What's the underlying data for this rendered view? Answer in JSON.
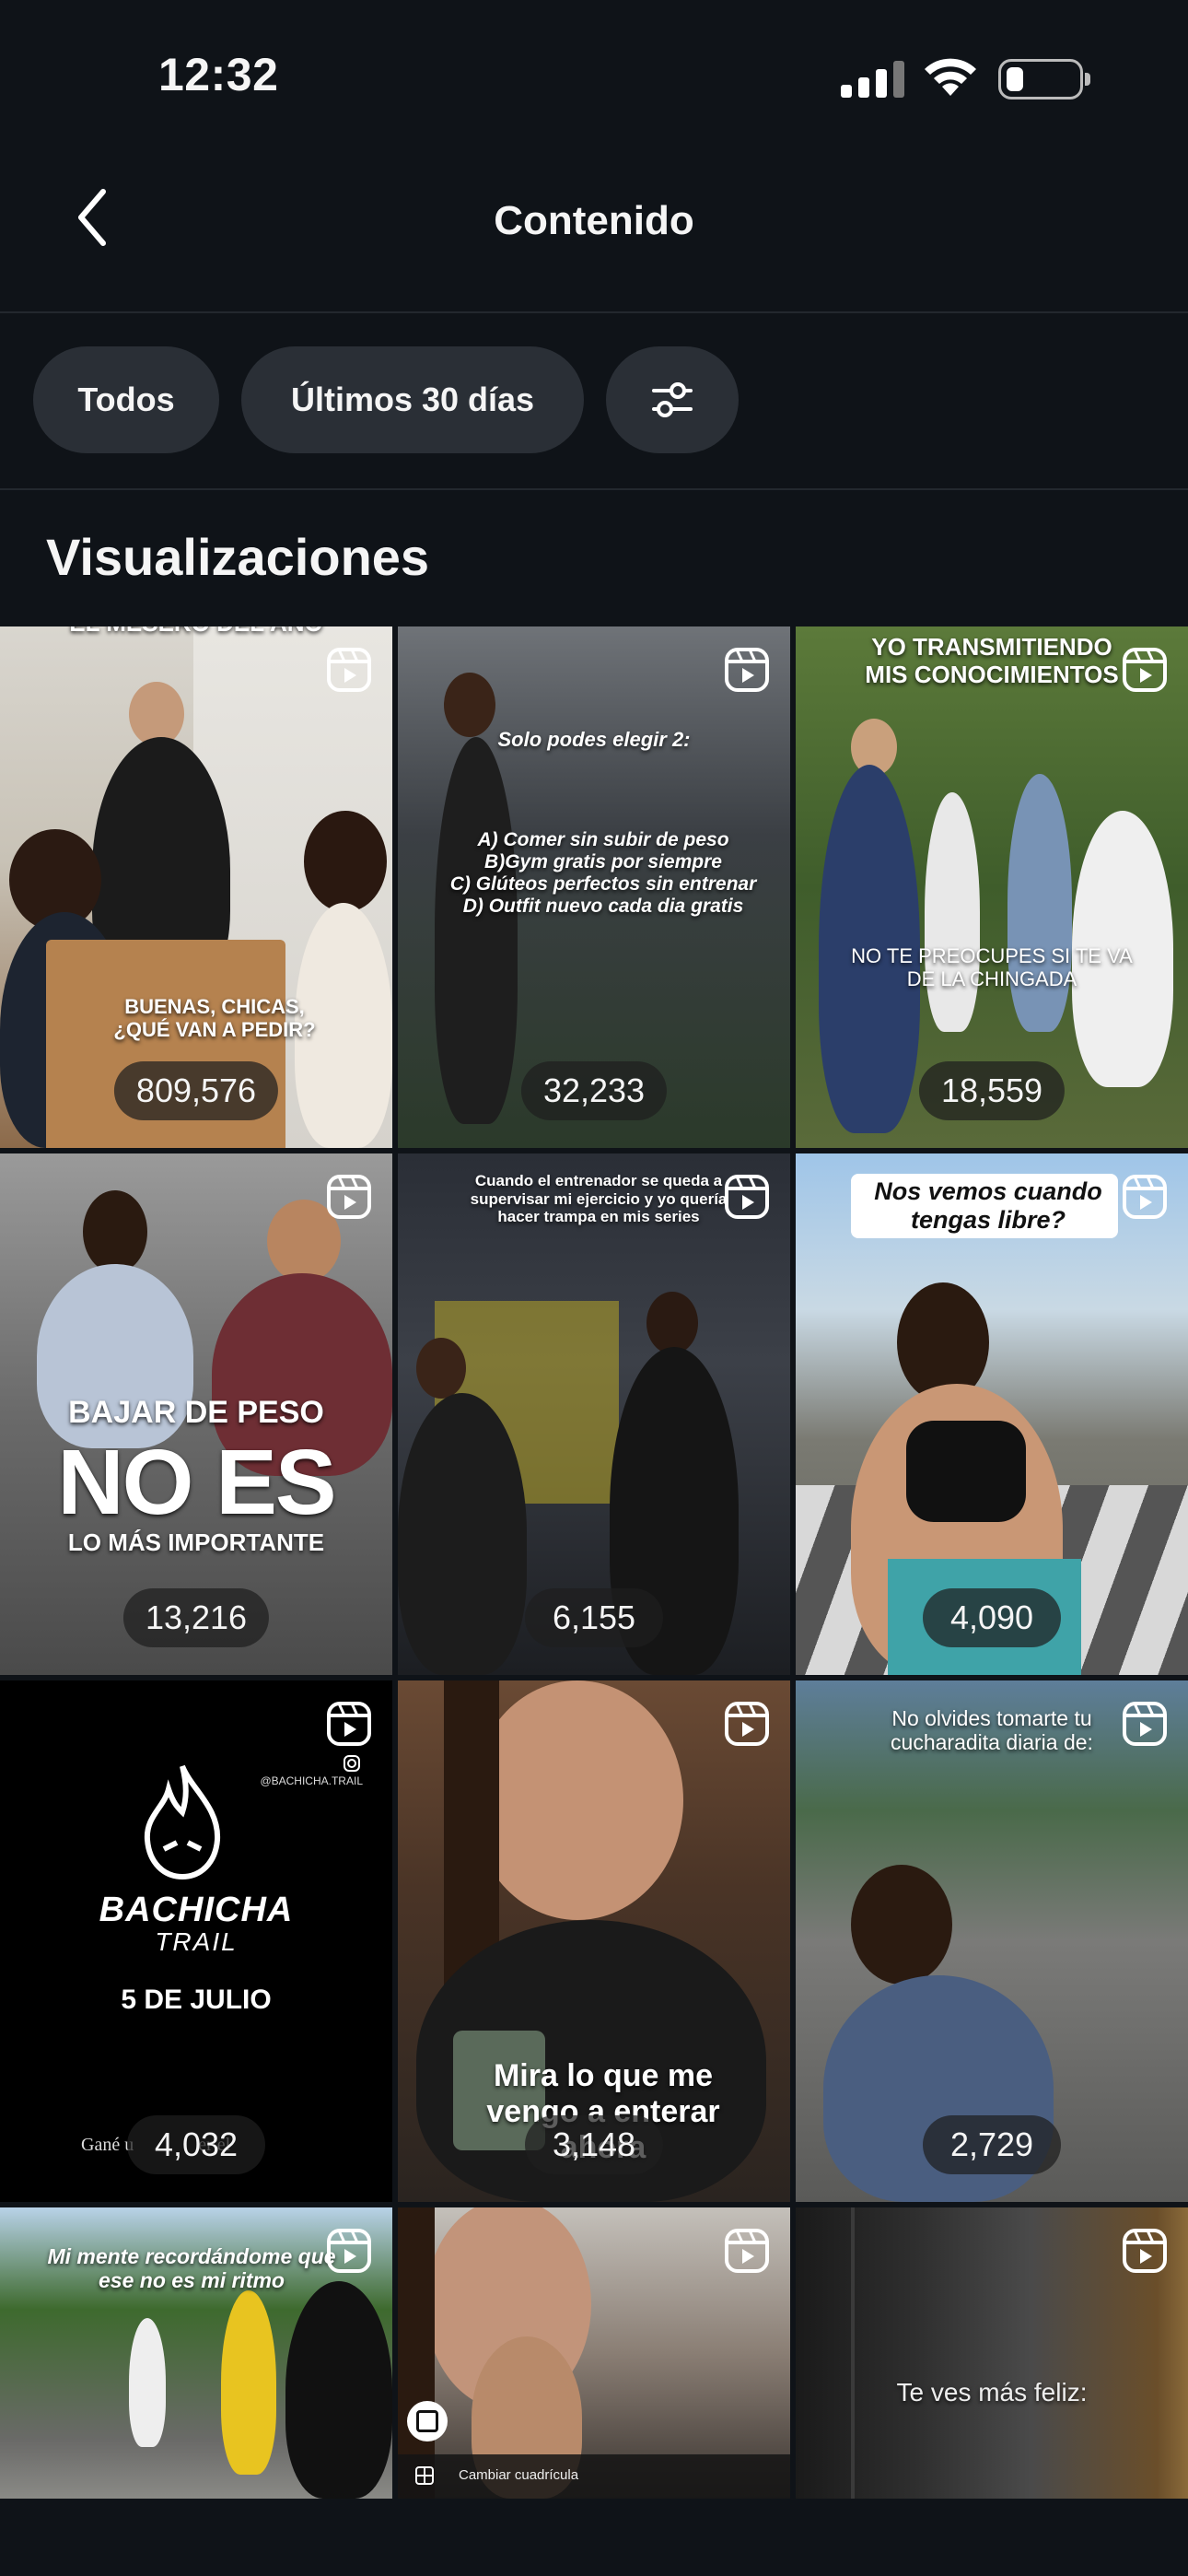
{
  "status": {
    "time": "12:32"
  },
  "header": {
    "title": "Contenido",
    "back_icon": "chevron-left-icon"
  },
  "filters": {
    "chips": [
      {
        "label": "Todos"
      },
      {
        "label": "Últimos 30 días"
      }
    ],
    "settings_icon": "sliders-icon"
  },
  "section": {
    "title": "Visualizaciones"
  },
  "tiles": [
    {
      "count": "809,576",
      "top_text": "EL MESERO DEL AÑO",
      "caption": "BUENAS, CHICAS,\n¿QUÉ VAN A PEDIR?"
    },
    {
      "count": "32,233",
      "top_text": "Solo podes elegir 2:",
      "caption": "A) Comer sin subir de peso\nB)Gym gratis por siempre\nC) Glúteos perfectos sin entrenar\nD) Outfit nuevo cada dia gratis"
    },
    {
      "count": "18,559",
      "top_text": "YO TRANSMITIENDO MIS CONOCIMIENTOS",
      "caption": "NO TE PREOCUPES SI TE VA DE LA CHINGADA"
    },
    {
      "count": "13,216",
      "top_text": "BAJAR DE PESO",
      "caption": "NO ES",
      "caption2": "LO MÁS IMPORTANTE"
    },
    {
      "count": "6,155",
      "top_text": "Cuando el entrenador se queda a supervisar mi ejercicio y yo quería hacer trampa en mis series"
    },
    {
      "count": "4,090",
      "top_text": "Nos vemos cuando tengas libre?"
    },
    {
      "count": "4,032",
      "brand": "BACHICHA",
      "brand_sub": "TRAIL",
      "date": "5 DE JULIO",
      "handle": "@BACHICHA.TRAIL",
      "footer": "Gané u              er el"
    },
    {
      "count": "3,148",
      "caption": "Mira lo que me vengo a enterar ahora"
    },
    {
      "count": "2,729",
      "top_text": "No olvides tomarte tu cucharadita diaria de:"
    },
    {
      "top_text": "Mi mente recordándome que ese no es mi ritmo"
    },
    {
      "footer": "Cambiar cuadrícula"
    },
    {
      "caption": "Te ves más feliz:"
    }
  ]
}
